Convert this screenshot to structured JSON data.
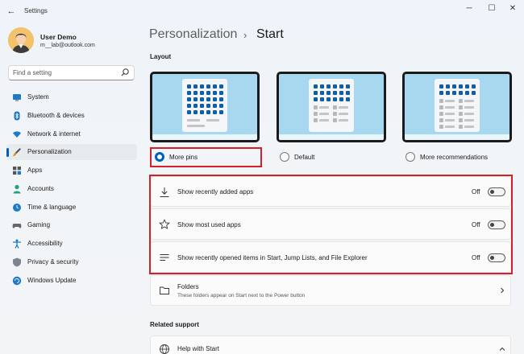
{
  "window": {
    "title": "Settings",
    "controls": {
      "minimize": "─",
      "maximize": "☐",
      "close": "✕"
    },
    "back_icon": "←"
  },
  "user": {
    "name": "User Demo",
    "email": "m__lab@outlook.com",
    "avatar_icon": "user-avatar"
  },
  "search": {
    "placeholder": "Find a setting",
    "value": ""
  },
  "sidebar": {
    "items": [
      {
        "label": "System",
        "icon": "monitor-icon",
        "active": false
      },
      {
        "label": "Bluetooth & devices",
        "icon": "bluetooth-icon",
        "active": false
      },
      {
        "label": "Network & internet",
        "icon": "wifi-icon",
        "active": false
      },
      {
        "label": "Personalization",
        "icon": "brush-icon",
        "active": true
      },
      {
        "label": "Apps",
        "icon": "apps-icon",
        "active": false
      },
      {
        "label": "Accounts",
        "icon": "person-icon",
        "active": false
      },
      {
        "label": "Time & language",
        "icon": "globe-clock-icon",
        "active": false
      },
      {
        "label": "Gaming",
        "icon": "gamepad-icon",
        "active": false
      },
      {
        "label": "Accessibility",
        "icon": "accessibility-icon",
        "active": false
      },
      {
        "label": "Privacy & security",
        "icon": "shield-icon",
        "active": false
      },
      {
        "label": "Windows Update",
        "icon": "update-icon",
        "active": false
      }
    ]
  },
  "breadcrumb": {
    "parent": "Personalization",
    "separator": "›",
    "current": "Start"
  },
  "layout": {
    "heading": "Layout",
    "options": [
      {
        "label": "More pins",
        "selected": true
      },
      {
        "label": "Default",
        "selected": false
      },
      {
        "label": "More recommendations",
        "selected": false
      }
    ]
  },
  "toggles": [
    {
      "label": "Show recently added apps",
      "state": "Off",
      "icon": "download-icon"
    },
    {
      "label": "Show most used apps",
      "state": "Off",
      "icon": "star-icon"
    },
    {
      "label": "Show recently opened items in Start, Jump Lists, and File Explorer",
      "state": "Off",
      "icon": "list-icon"
    }
  ],
  "folders": {
    "label": "Folders",
    "sublabel": "These folders appear on Start next to the Power button",
    "icon": "folder-icon"
  },
  "related": {
    "heading": "Related support",
    "item": "Help with Start",
    "icon": "globe-icon"
  },
  "colors": {
    "accent": "#005fb8",
    "highlight": "#d3202a"
  }
}
